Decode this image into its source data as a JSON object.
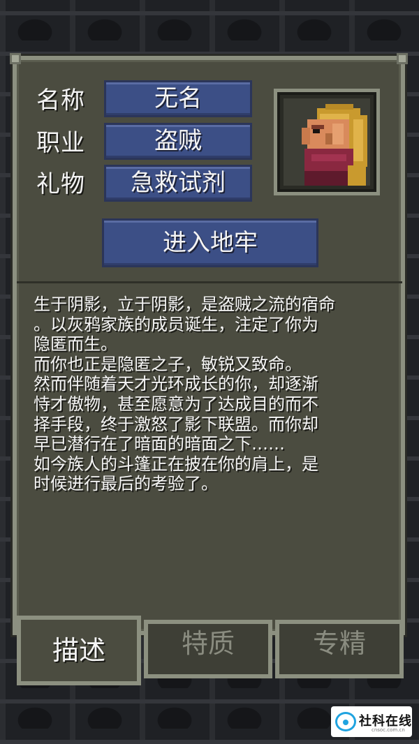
{
  "profile": {
    "name_label": "名称",
    "name_value": "无名",
    "class_label": "职业",
    "class_value": "盗贼",
    "gift_label": "礼物",
    "gift_value": "急救试剂"
  },
  "actions": {
    "enter_dungeon": "进入地牢"
  },
  "description": "生于阴影，立于阴影，是盗贼之流的宿命\n。以灰鸦家族的成员诞生，注定了你为\n隐匿而生。\n而你也正是隐匿之子，敏锐又致命。\n然而伴随着天才光环成长的你，却逐渐\n恃才傲物，甚至愿意为了达成目的而不\n择手段，终于激怒了影下联盟。而你却\n早已潜行在了暗面的暗面之下……\n如今族人的斗篷正在披在你的肩上，是\n时候进行最后的考验了。",
  "tabs": [
    {
      "label": "描述",
      "active": true
    },
    {
      "label": "特质",
      "active": false
    },
    {
      "label": "专精",
      "active": false
    }
  ],
  "watermark": {
    "text": "社科在线",
    "sub": "cnsoc.com.cn"
  },
  "colors": {
    "panel": "#4b4c40",
    "panel_border": "#8c9080",
    "button": "#3c4f86",
    "text": "#f5f5f5",
    "tab_inactive_text": "#8a8c80"
  },
  "icons": {
    "portrait": "rogue-hero-portrait"
  }
}
